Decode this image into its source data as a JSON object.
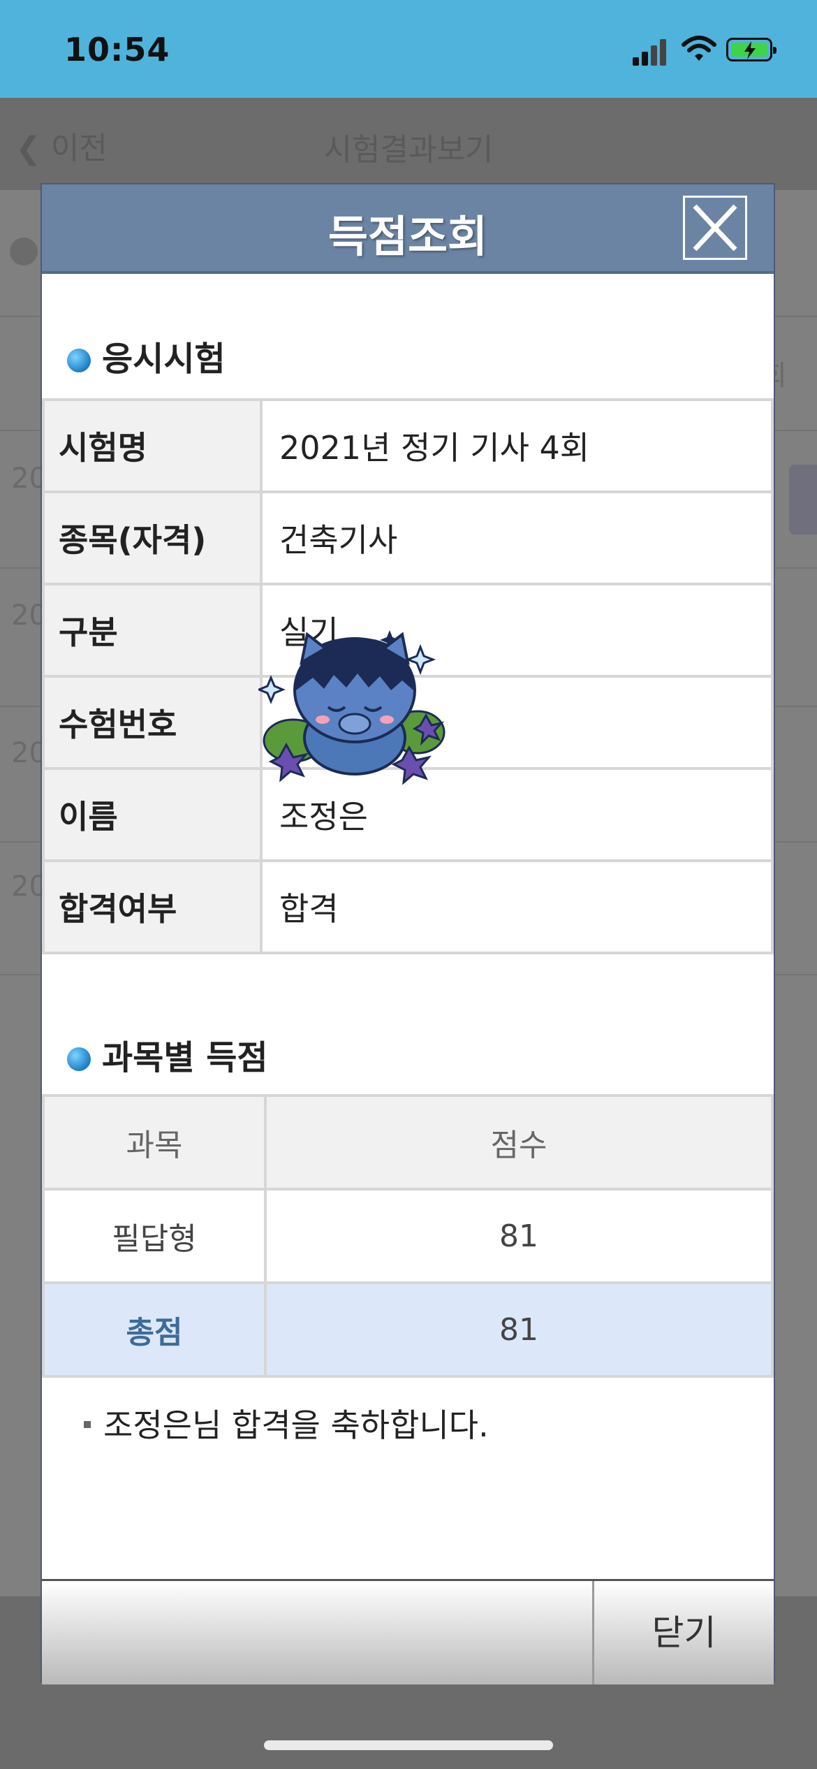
{
  "status_bar": {
    "time": "10:54"
  },
  "background_page": {
    "back_label": "이전",
    "title": "시험결과보기",
    "row_prefix": "20",
    "right_edge_text": "회"
  },
  "modal": {
    "title": "득점조회",
    "section_exam": "응시시험",
    "info_rows": [
      {
        "label": "시험명",
        "value": "2021년 정기 기사 4회"
      },
      {
        "label": "종목(자격)",
        "value": "건축기사"
      },
      {
        "label": "구분",
        "value": "실기"
      },
      {
        "label": "수험번호",
        "value": ""
      },
      {
        "label": "이름",
        "value": "조정은"
      },
      {
        "label": "합격여부",
        "value": "합격"
      }
    ],
    "section_scores": "과목별 득점",
    "score_header": {
      "subject": "과목",
      "score": "점수"
    },
    "score_rows": [
      {
        "subject": "필답형",
        "score": "81"
      }
    ],
    "total": {
      "label": "총점",
      "score": "81"
    },
    "message": "조정은님 합격을 축하합니다.",
    "close_label": "닫기"
  },
  "colors": {
    "status_bar": "#4fb3dc",
    "modal_header": "#6b84a4",
    "total_row": "#dce8fa",
    "battery": "#3fd34a"
  }
}
